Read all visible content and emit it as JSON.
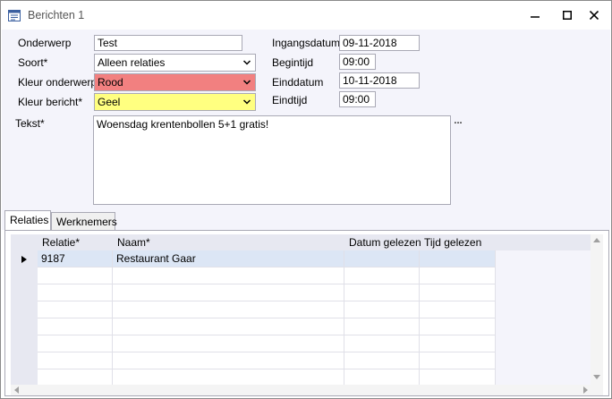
{
  "window": {
    "title": "Berichten 1"
  },
  "form": {
    "onderwerp": {
      "label": "Onderwerp",
      "value": "Test"
    },
    "soort": {
      "label": "Soort*",
      "value": "Alleen relaties"
    },
    "kleur_onderwerp": {
      "label": "Kleur onderwerp*",
      "value": "Rood",
      "color": "#f28080"
    },
    "kleur_bericht": {
      "label": "Kleur bericht*",
      "value": "Geel",
      "color": "#ffff80"
    },
    "ingangsdatum": {
      "label": "Ingangsdatum*",
      "value": "09-11-2018"
    },
    "begintijd": {
      "label": "Begintijd",
      "value": "09:00"
    },
    "einddatum": {
      "label": "Einddatum",
      "value": "10-11-2018"
    },
    "eindtijd": {
      "label": "Eindtijd",
      "value": "09:00"
    },
    "tekst": {
      "label": "Tekst*",
      "value": "Woensdag krentenbollen 5+1 gratis!"
    },
    "ellipsis_label": "..."
  },
  "tabs": [
    {
      "label": "Relaties",
      "active": true
    },
    {
      "label": "Werknemers",
      "active": false
    }
  ],
  "grid": {
    "columns": [
      "Relatie*",
      "Naam*",
      "Datum gelezen",
      "Tijd gelezen"
    ],
    "rows": [
      {
        "relatie": "9187",
        "naam": "Restaurant Gaar",
        "datum": "",
        "tijd": ""
      }
    ]
  }
}
